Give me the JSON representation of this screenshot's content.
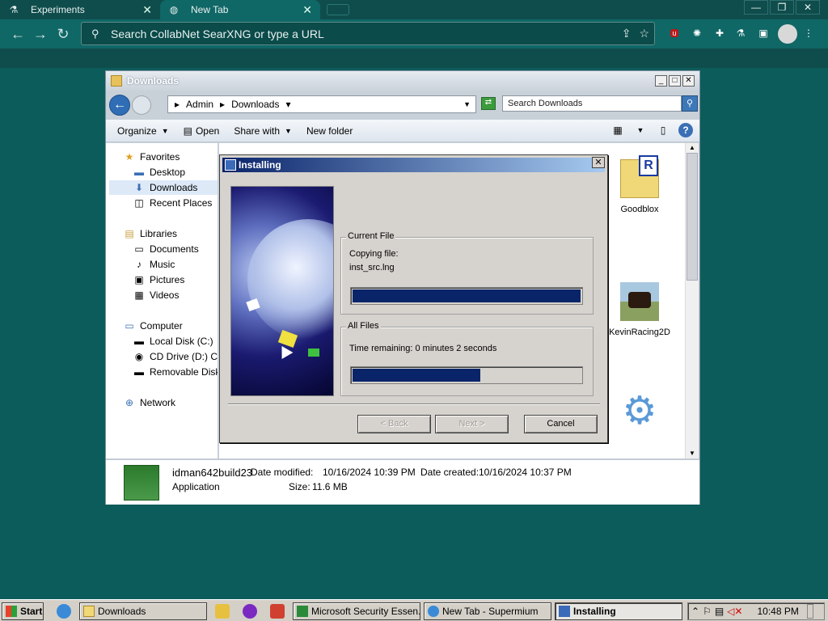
{
  "browser": {
    "tabs": [
      {
        "label": "Experiments",
        "icon": "flask-icon"
      },
      {
        "label": "New Tab",
        "icon": "globe-icon"
      }
    ],
    "address_placeholder": "Search CollabNet SearXNG or type a URL",
    "window_controls": [
      "—",
      "❐",
      "✕"
    ]
  },
  "explorer": {
    "title": "Downloads",
    "breadcrumb": [
      "Admin",
      "Downloads"
    ],
    "search_placeholder": "Search Downloads",
    "commands": [
      "Organize",
      "Open",
      "Share with",
      "New folder"
    ],
    "nav": {
      "favorites": "Favorites",
      "favorites_items": [
        "Desktop",
        "Downloads",
        "Recent Places"
      ],
      "libraries": "Libraries",
      "libraries_items": [
        "Documents",
        "Music",
        "Pictures",
        "Videos"
      ],
      "computer": "Computer",
      "computer_items": [
        "Local Disk (C:)",
        "CD Drive (D:) CDR",
        "Removable Disk (E"
      ],
      "network": "Network"
    },
    "files": [
      {
        "name": "Goodblox"
      },
      {
        "name": "KevinRacing2D"
      }
    ],
    "details": {
      "name": "idman642build23",
      "type": "Application",
      "modified_label": "Date modified:",
      "modified_value": "10/16/2024 10:39 PM",
      "created_label": "Date created:",
      "created_value": "10/16/2024 10:37 PM",
      "size_label": "Size:",
      "size_value": "11.6 MB"
    }
  },
  "installer": {
    "title": "Installing",
    "current_file_group": "Current File",
    "copying_label": "Copying file:",
    "copying_file": "inst_src.lng",
    "current_progress": 1.0,
    "all_files_group": "All Files",
    "time_remaining": "Time remaining: 0 minutes 2 seconds",
    "all_progress": 0.56,
    "buttons": {
      "back": "< Back",
      "next": "Next >",
      "cancel": "Cancel"
    }
  },
  "taskbar": {
    "start": "Start",
    "tasks": [
      "Downloads",
      "Microsoft Security Essen...",
      "New Tab - Supermium",
      "Installing"
    ],
    "clock": "10:48 PM"
  }
}
